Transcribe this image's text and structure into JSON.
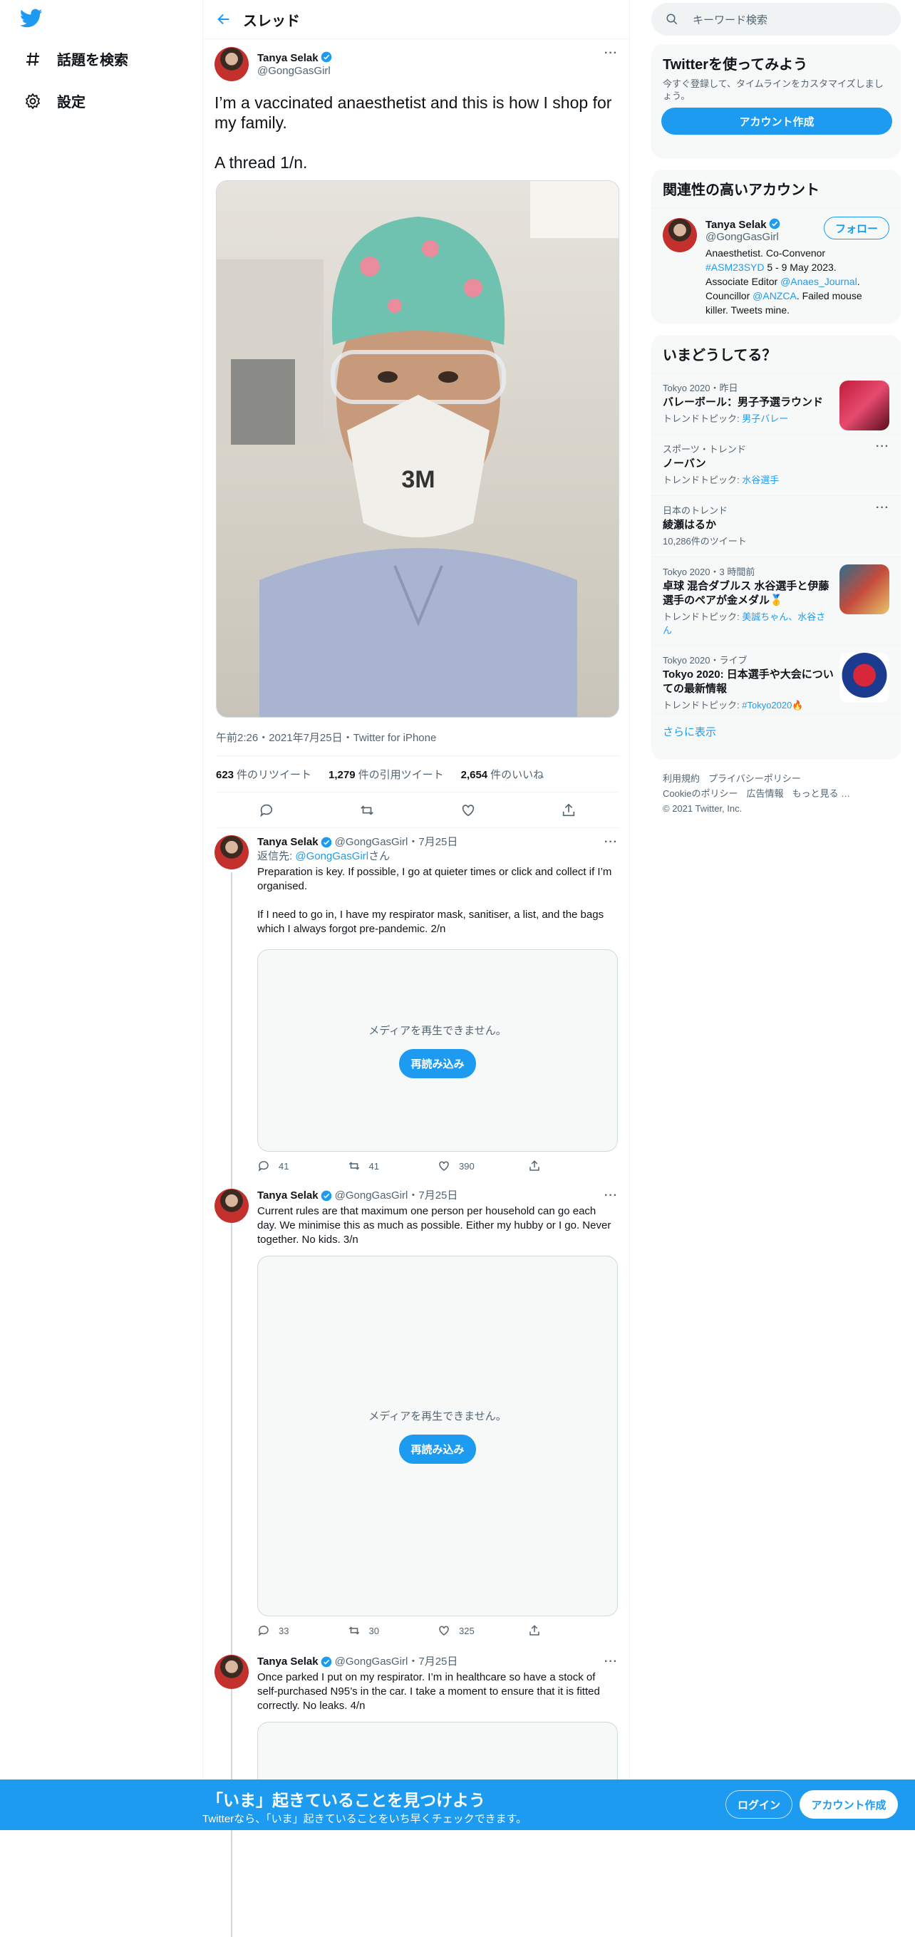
{
  "nav": {
    "explore": "話題を検索",
    "settings": "設定"
  },
  "header": {
    "title": "スレッド"
  },
  "main_tweet": {
    "name": "Tanya Selak",
    "handle": "@GongGasGirl",
    "text": "I’m a vaccinated anaesthetist and this is how I shop for my family.\n\nA thread 1/n.",
    "photo_mask_brand": "3M",
    "meta": "午前2:26・2021年7月25日・Twitter for iPhone",
    "retweets_count": "623",
    "retweets_label": "件のリツイート",
    "quotes_count": "1,279",
    "quotes_label": "件の引用ツイート",
    "likes_count": "2,654",
    "likes_label": "件のいいね"
  },
  "replies": [
    {
      "name": "Tanya Selak",
      "handle": "@GongGasGirl",
      "date": "・7月25日",
      "reply_to_prefix": "返信先: ",
      "reply_to_handle": "@GongGasGirl",
      "reply_to_suffix": "さん",
      "text": "Preparation is key. If possible, I go at quieter times or click and collect if I’m organised.\n\nIf I need to go in, I have my respirator mask, sanitiser, a list, and the bags which I always forgot pre-pandemic. 2/n",
      "media_msg": "メディアを再生できません。",
      "media_btn": "再読み込み",
      "replies": "41",
      "retweets": "41",
      "likes": "390"
    },
    {
      "name": "Tanya Selak",
      "handle": "@GongGasGirl",
      "date": "・7月25日",
      "text": "Current rules are that maximum one person per household can go each day. We minimise this as much as possible. Either my hubby or I go. Never together. No kids. 3/n",
      "media_msg": "メディアを再生できません。",
      "media_btn": "再読み込み",
      "replies": "33",
      "retweets": "30",
      "likes": "325"
    },
    {
      "name": "Tanya Selak",
      "handle": "@GongGasGirl",
      "date": "・7月25日",
      "text": "Once parked I put on my respirator. I’m in healthcare so have a stock of self-purchased N95’s in the car. I take a moment to ensure that it is fitted correctly. No leaks. 4/n"
    }
  ],
  "search": {
    "placeholder": "キーワード検索"
  },
  "signup_panel": {
    "title": "Twitterを使ってみよう",
    "desc": "今すぐ登録して、タイムラインをカスタマイズしましょう。",
    "button": "アカウント作成"
  },
  "relevant": {
    "title": "関連性の高いアカウント",
    "name": "Tanya Selak",
    "handle": "@GongGasGirl",
    "follow": "フォロー",
    "bio_1": "Anaesthetist. Co-Convenor ",
    "bio_tag": "#ASM23SYD",
    "bio_2": " 5 - 9 May 2023. Associate Editor ",
    "bio_link1": "@Anaes_Journal",
    "bio_3": ". Councillor ",
    "bio_link2": "@ANZCA",
    "bio_4": ". Failed mouse killer. Tweets mine."
  },
  "trends": {
    "title": "いまどうしてる？",
    "items": [
      {
        "context": "Tokyo 2020・昨日",
        "name": "バレーボール：男子予選ラウンド",
        "sub_prefix": "トレンドトピック: ",
        "sub_link": "男子バレー"
      },
      {
        "context": "スポーツ・トレンド",
        "name": "ノーバン",
        "sub_prefix": "トレンドトピック: ",
        "sub_link": "水谷選手"
      },
      {
        "context": "日本のトレンド",
        "name": "綾瀬はるか",
        "sub_prefix": "10,286件のツイート",
        "sub_link": ""
      },
      {
        "context": "Tokyo 2020・3 時間前",
        "name": "卓球 混合ダブルス 水谷選手と伊藤選手のペアが金メダル🥇",
        "sub_prefix": "トレンドトピック: ",
        "sub_link": "美誠ちゃん、水谷さん"
      },
      {
        "context": "Tokyo 2020・ライブ",
        "name": "Tokyo 2020: 日本選手や大会についての最新情報",
        "sub_prefix": "トレンドトピック: ",
        "sub_link": "#Tokyo2020🔥"
      }
    ],
    "more": "さらに表示"
  },
  "footer": {
    "terms": "利用規約",
    "privacy": "プライバシーポリシー",
    "cookie": "Cookieのポリシー",
    "ads": "広告情報",
    "more": "もっと見る …",
    "copyright": "© 2021 Twitter, Inc."
  },
  "bottom_bar": {
    "title": "「いま」起きていることを見つけよう",
    "subtitle": "Twitterなら、「いま」起きていることをいち早くチェックできます。",
    "login": "ログイン",
    "signup": "アカウント作成"
  }
}
